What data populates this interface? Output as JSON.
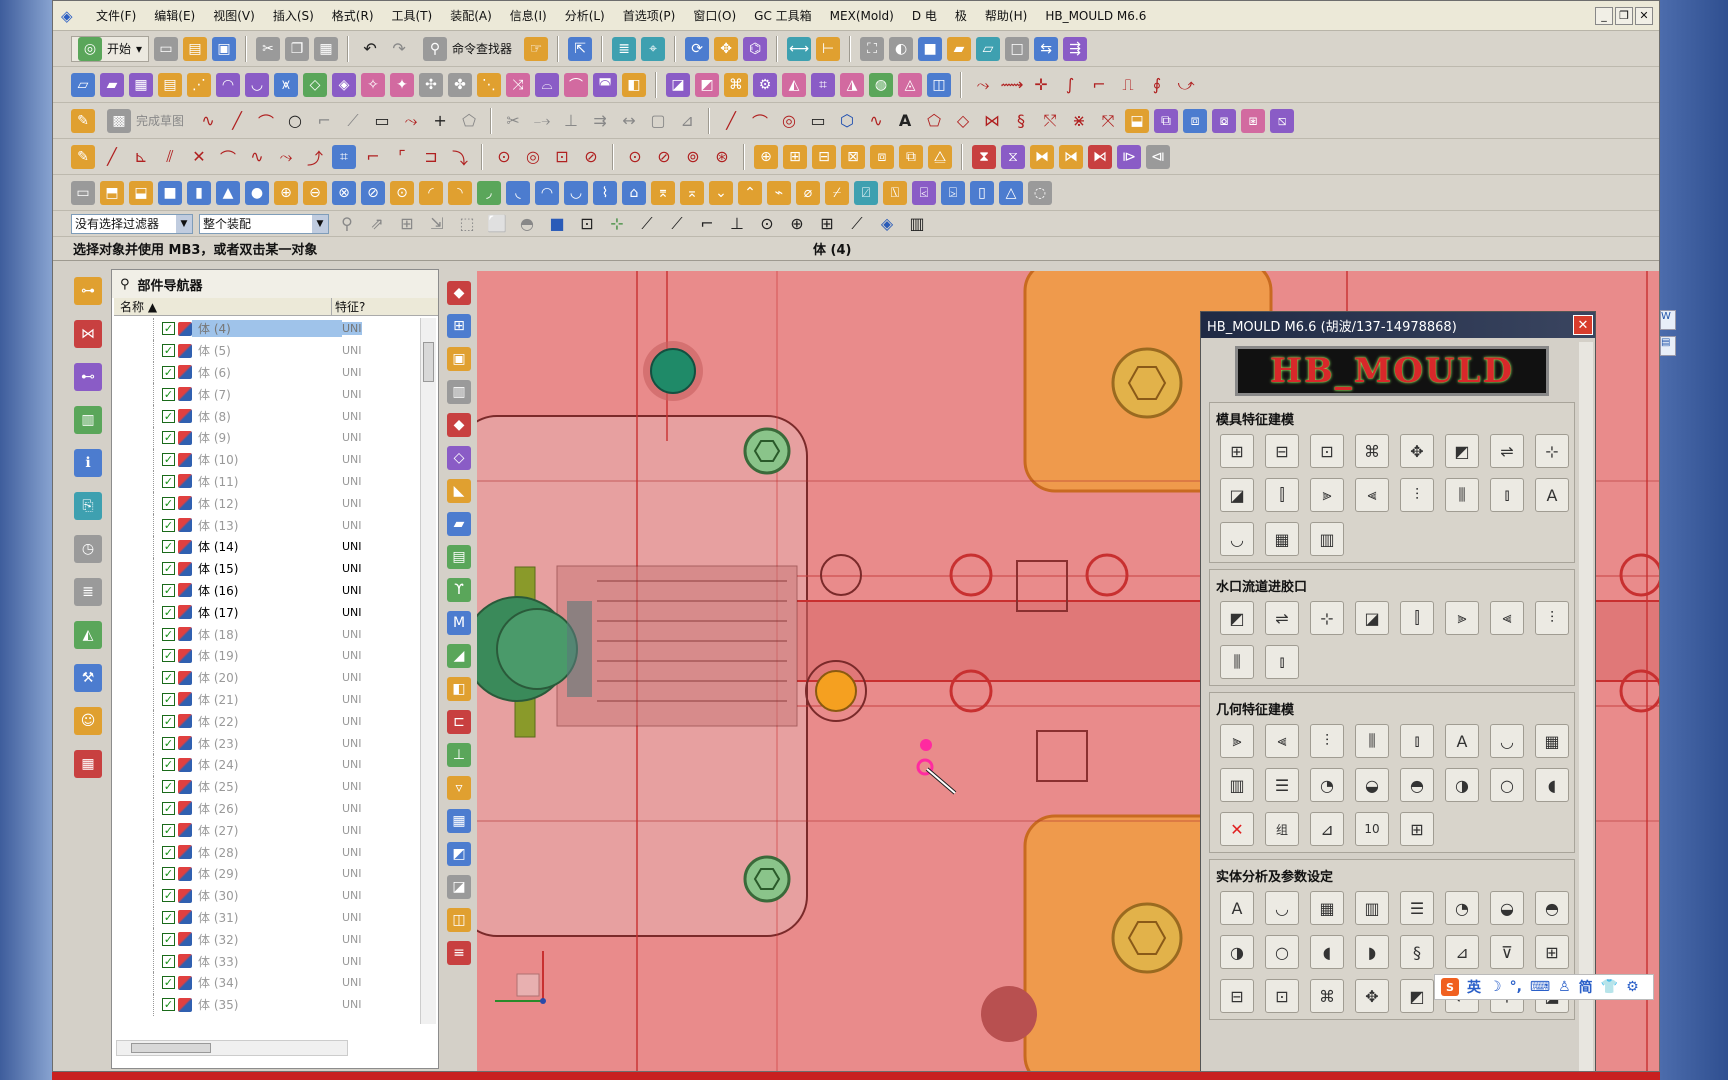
{
  "menubar": {
    "items": [
      "文件(F)",
      "编辑(E)",
      "视图(V)",
      "插入(S)",
      "格式(R)",
      "工具(T)",
      "装配(A)",
      "信息(I)",
      "分析(L)",
      "首选项(P)",
      "窗口(O)",
      "GC 工具箱",
      "MEX(Mold)",
      "D 电",
      "极",
      "帮助(H)",
      "HB_MOULD M6.6"
    ]
  },
  "toolbar1": {
    "start_label": "开始",
    "command_finder_label": "命令查找器"
  },
  "toolbar3": {
    "finish_sketch_label": "完成草图"
  },
  "selection": {
    "filter_value": "没有选择过滤器",
    "scope_value": "整个装配"
  },
  "cue": {
    "prompt": "选择对象并使用 MB3，或者双击某一对象",
    "status": "体 (4)"
  },
  "navigator": {
    "title": "部件导航器",
    "col_name": "名称",
    "col_feature": "特征?",
    "rows": [
      {
        "label": "体 (4)",
        "feat": "UNI",
        "state": "selected"
      },
      {
        "label": "体 (5)",
        "feat": "UNI",
        "state": "dim"
      },
      {
        "label": "体 (6)",
        "feat": "UNI",
        "state": "dim"
      },
      {
        "label": "体 (7)",
        "feat": "UNI",
        "state": "dim"
      },
      {
        "label": "体 (8)",
        "feat": "UNI",
        "state": "dim"
      },
      {
        "label": "体 (9)",
        "feat": "UNI",
        "state": "dim"
      },
      {
        "label": "体 (10)",
        "feat": "UNI",
        "state": "dim"
      },
      {
        "label": "体 (11)",
        "feat": "UNI",
        "state": "dim"
      },
      {
        "label": "体 (12)",
        "feat": "UNI",
        "state": "dim"
      },
      {
        "label": "体 (13)",
        "feat": "UNI",
        "state": "dim"
      },
      {
        "label": "体 (14)",
        "feat": "UNI",
        "state": "active"
      },
      {
        "label": "体 (15)",
        "feat": "UNI",
        "state": "active"
      },
      {
        "label": "体 (16)",
        "feat": "UNI",
        "state": "active"
      },
      {
        "label": "体 (17)",
        "feat": "UNI",
        "state": "active"
      },
      {
        "label": "体 (18)",
        "feat": "UNI",
        "state": "dim"
      },
      {
        "label": "体 (19)",
        "feat": "UNI",
        "state": "dim"
      },
      {
        "label": "体 (20)",
        "feat": "UNI",
        "state": "dim"
      },
      {
        "label": "体 (21)",
        "feat": "UNI",
        "state": "dim"
      },
      {
        "label": "体 (22)",
        "feat": "UNI",
        "state": "dim"
      },
      {
        "label": "体 (23)",
        "feat": "UNI",
        "state": "dim"
      },
      {
        "label": "体 (24)",
        "feat": "UNI",
        "state": "dim"
      },
      {
        "label": "体 (25)",
        "feat": "UNI",
        "state": "dim"
      },
      {
        "label": "体 (26)",
        "feat": "UNI",
        "state": "dim"
      },
      {
        "label": "体 (27)",
        "feat": "UNI",
        "state": "dim"
      },
      {
        "label": "体 (28)",
        "feat": "UNI",
        "state": "dim"
      },
      {
        "label": "体 (29)",
        "feat": "UNI",
        "state": "dim"
      },
      {
        "label": "体 (30)",
        "feat": "UNI",
        "state": "dim"
      },
      {
        "label": "体 (31)",
        "feat": "UNI",
        "state": "dim"
      },
      {
        "label": "体 (32)",
        "feat": "UNI",
        "state": "dim"
      },
      {
        "label": "体 (33)",
        "feat": "UNI",
        "state": "dim"
      },
      {
        "label": "体 (34)",
        "feat": "UNI",
        "state": "dim"
      },
      {
        "label": "体 (35)",
        "feat": "UNI",
        "state": "dim"
      }
    ]
  },
  "hb_mould": {
    "title": "HB_MOULD M6.6 (胡波/137-14978868)",
    "logo_text": "HB_MOULD",
    "sections": [
      {
        "title": "模具特征建模",
        "count": 19
      },
      {
        "title": "水口流道进胶口",
        "count": 10
      },
      {
        "title": "几何特征建模",
        "count": 21
      },
      {
        "title": "实体分析及参数设定",
        "count": 24
      }
    ],
    "group_button_label": "组",
    "count_badge": "10"
  },
  "ime": {
    "lang": "英",
    "mode": "简"
  },
  "colors": {
    "graphics_bg": "#e88a8a",
    "orange_plate": "#f0a040",
    "green_pin": "#2a9a6a",
    "accent_orange": "#f5a020"
  }
}
